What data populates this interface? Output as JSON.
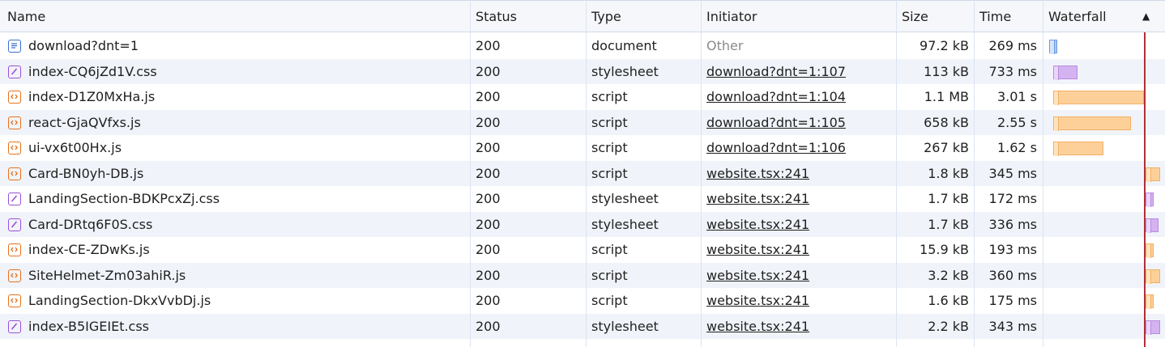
{
  "header": {
    "columns": [
      "Name",
      "Status",
      "Type",
      "Initiator",
      "Size",
      "Time",
      "Waterfall"
    ],
    "sort_indicator": "▲"
  },
  "rows": [
    {
      "name": "download?dnt=1",
      "status": "200",
      "type": "document",
      "initiator": "Other",
      "size": "97.2 kB",
      "time": "269 ms",
      "icon": "document-icon"
    },
    {
      "name": "index-CQ6jZd1V.css",
      "status": "200",
      "type": "stylesheet",
      "initiator": "download?dnt=1:107",
      "size": "113 kB",
      "time": "733 ms",
      "icon": "stylesheet-icon"
    },
    {
      "name": "index-D1Z0MxHa.js",
      "status": "200",
      "type": "script",
      "initiator": "download?dnt=1:104",
      "size": "1.1 MB",
      "time": "3.01 s",
      "icon": "script-icon"
    },
    {
      "name": "react-GjaQVfxs.js",
      "status": "200",
      "type": "script",
      "initiator": "download?dnt=1:105",
      "size": "658 kB",
      "time": "2.55 s",
      "icon": "script-icon"
    },
    {
      "name": "ui-vx6t00Hx.js",
      "status": "200",
      "type": "script",
      "initiator": "download?dnt=1:106",
      "size": "267 kB",
      "time": "1.62 s",
      "icon": "script-icon"
    },
    {
      "name": "Card-BN0yh-DB.js",
      "status": "200",
      "type": "script",
      "initiator": "website.tsx:241",
      "size": "1.8 kB",
      "time": "345 ms",
      "icon": "script-icon"
    },
    {
      "name": "LandingSection-BDKPcxZj.css",
      "status": "200",
      "type": "stylesheet",
      "initiator": "website.tsx:241",
      "size": "1.7 kB",
      "time": "172 ms",
      "icon": "stylesheet-icon"
    },
    {
      "name": "Card-DRtq6F0S.css",
      "status": "200",
      "type": "stylesheet",
      "initiator": "website.tsx:241",
      "size": "1.7 kB",
      "time": "336 ms",
      "icon": "stylesheet-icon"
    },
    {
      "name": "index-CE-ZDwKs.js",
      "status": "200",
      "type": "script",
      "initiator": "website.tsx:241",
      "size": "15.9 kB",
      "time": "193 ms",
      "icon": "script-icon"
    },
    {
      "name": "SiteHelmet-Zm03ahiR.js",
      "status": "200",
      "type": "script",
      "initiator": "website.tsx:241",
      "size": "3.2 kB",
      "time": "360 ms",
      "icon": "script-icon"
    },
    {
      "name": "LandingSection-DkxVvbDj.js",
      "status": "200",
      "type": "script",
      "initiator": "website.tsx:241",
      "size": "1.6 kB",
      "time": "175 ms",
      "icon": "script-icon"
    },
    {
      "name": "index-B5IGEIEt.css",
      "status": "200",
      "type": "stylesheet",
      "initiator": "website.tsx:241",
      "size": "2.2 kB",
      "time": "343 ms",
      "icon": "stylesheet-icon"
    }
  ],
  "colors": {
    "script": "#e8711a",
    "stylesheet": "#9b4fd9",
    "document": "#3a6fd8",
    "load_line": "#b0303a"
  }
}
